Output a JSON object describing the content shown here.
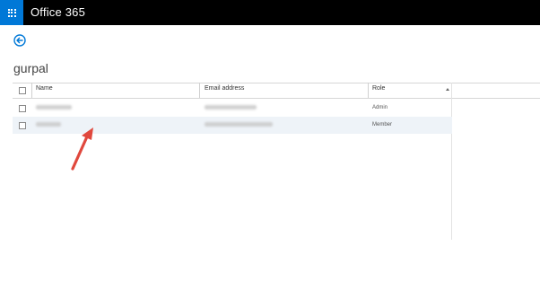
{
  "app": {
    "title": "Office 365",
    "accent_color": "#0078d7",
    "topbar_color": "#000000",
    "launcher_icon": "app-launcher-icon"
  },
  "nav": {
    "back_icon": "back-arrow-icon"
  },
  "group": {
    "name": "gurpal"
  },
  "table": {
    "columns": [
      {
        "label": "Name"
      },
      {
        "label": "Email address"
      },
      {
        "label": "Role",
        "sort": "ascending"
      }
    ],
    "rows": [
      {
        "name": "",
        "email": "",
        "role": "Admin",
        "selected": false
      },
      {
        "name": "",
        "email": "",
        "role": "Member",
        "selected": true
      }
    ]
  },
  "annotation": {
    "arrow_color": "#e0483d",
    "icon": "red-arrow-annotation"
  }
}
